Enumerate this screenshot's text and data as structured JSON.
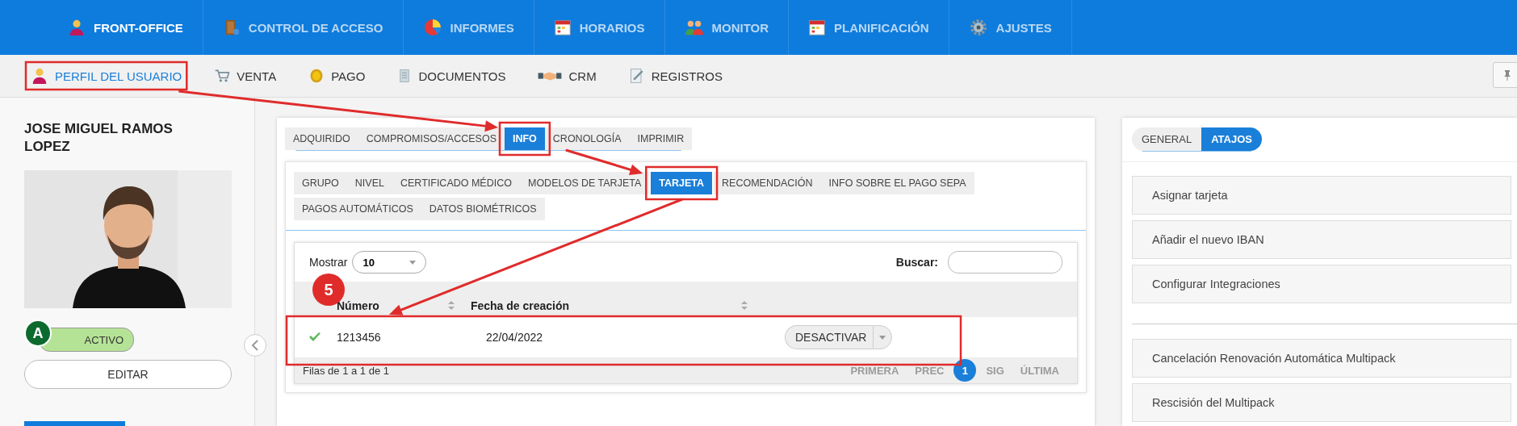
{
  "top_nav": [
    {
      "label": "FRONT-OFFICE",
      "selected": true
    },
    {
      "label": "CONTROL DE ACCESO",
      "selected": false
    },
    {
      "label": "INFORMES",
      "selected": false
    },
    {
      "label": "HORARIOS",
      "selected": false
    },
    {
      "label": "MONITOR",
      "selected": false
    },
    {
      "label": "PLANIFICACIÓN",
      "selected": false
    },
    {
      "label": "AJUSTES",
      "selected": false
    }
  ],
  "sub_nav": [
    {
      "label": "PERFIL DEL USUARIO",
      "selected": true
    },
    {
      "label": "VENTA",
      "selected": false
    },
    {
      "label": "PAGO",
      "selected": false
    },
    {
      "label": "DOCUMENTOS",
      "selected": false
    },
    {
      "label": "CRM",
      "selected": false
    },
    {
      "label": "REGISTROS",
      "selected": false
    }
  ],
  "profile": {
    "name": "JOSE MIGUEL RAMOS LOPEZ",
    "status_letter": "A",
    "status": "ACTIVO",
    "edit_button": "EDITAR"
  },
  "main_tabs": [
    {
      "label": "ADQUIRIDO",
      "selected": false
    },
    {
      "label": "COMPROMISOS/ACCESOS",
      "selected": false
    },
    {
      "label": "INFO",
      "selected": true
    },
    {
      "label": "CRONOLOGÍA",
      "selected": false
    },
    {
      "label": "IMPRIMIR",
      "selected": false
    }
  ],
  "info_tabs": [
    {
      "label": "GRUPO",
      "selected": false
    },
    {
      "label": "NIVEL",
      "selected": false
    },
    {
      "label": "CERTIFICADO MÉDICO",
      "selected": false
    },
    {
      "label": "MODELOS DE TARJETA",
      "selected": false
    },
    {
      "label": "TARJETA",
      "selected": true
    },
    {
      "label": "RECOMENDACIÓN",
      "selected": false
    },
    {
      "label": "INFO SOBRE EL PAGO SEPA",
      "selected": false
    },
    {
      "label": "PAGOS AUTOMÁTICOS",
      "selected": false
    },
    {
      "label": "DATOS BIOMÉTRICOS",
      "selected": false
    }
  ],
  "table": {
    "show_label": "Mostrar",
    "page_size": "10",
    "search_label": "Buscar:",
    "columns": [
      "Número",
      "Fecha de creación"
    ],
    "rows": [
      {
        "active": true,
        "number": "1213456",
        "date": "22/04/2022",
        "action": "DESACTIVAR"
      }
    ],
    "summary": "Filas de 1 a 1 de 1",
    "pagination": [
      {
        "label": "PRIMERA",
        "selected": false,
        "disabled": true
      },
      {
        "label": "PREC",
        "selected": false,
        "disabled": true
      },
      {
        "label": "1",
        "selected": true,
        "disabled": false
      },
      {
        "label": "SIG",
        "selected": false,
        "disabled": true
      },
      {
        "label": "ÚLTIMA",
        "selected": false,
        "disabled": true
      }
    ]
  },
  "side_tabs": [
    {
      "label": "GENERAL",
      "selected": false
    },
    {
      "label": "ATAJOS",
      "selected": true
    }
  ],
  "shortcut_groups": [
    {
      "items": [
        "Asignar tarjeta",
        "Añadir el nuevo IBAN",
        "Configurar Integraciones"
      ]
    },
    {
      "items": [
        "Cancelación Renovación Automática Multipack",
        "Rescisión del Multipack"
      ]
    }
  ],
  "annotation": {
    "step": "5"
  }
}
